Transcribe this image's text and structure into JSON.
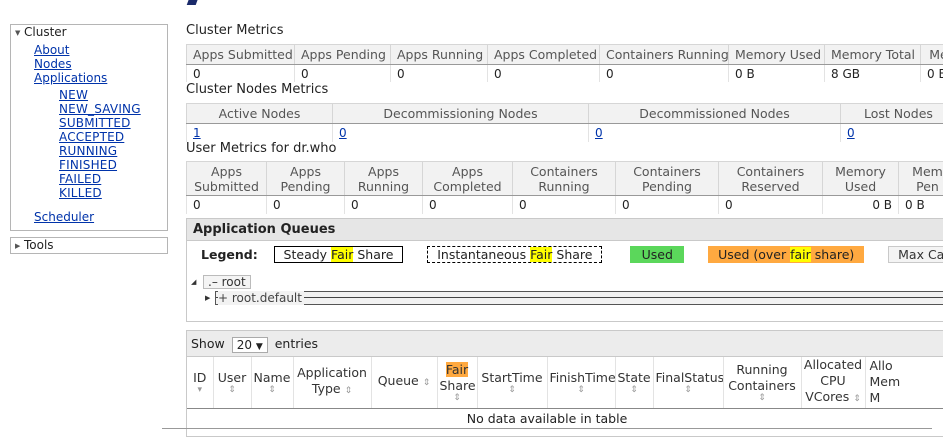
{
  "sidebar": {
    "cluster": {
      "title": "Cluster",
      "links": [
        "About",
        "Nodes",
        "Applications"
      ],
      "app_states": [
        "NEW",
        "NEW_SAVING",
        "SUBMITTED",
        "ACCEPTED",
        "RUNNING",
        "FINISHED",
        "FAILED",
        "KILLED"
      ],
      "scheduler": "Scheduler"
    },
    "tools": {
      "title": "Tools"
    }
  },
  "cluster_metrics": {
    "title": "Cluster Metrics",
    "headers": [
      "Apps Submitted",
      "Apps Pending",
      "Apps Running",
      "Apps Completed",
      "Containers Running",
      "Memory Used",
      "Memory Total",
      "Me"
    ],
    "values": [
      "0",
      "0",
      "0",
      "0",
      "0",
      "0 B",
      "8 GB",
      "0 B"
    ]
  },
  "cluster_nodes_metrics": {
    "title": "Cluster Nodes Metrics",
    "headers": [
      "Active Nodes",
      "Decommissioning Nodes",
      "Decommissioned Nodes",
      "Lost Nodes"
    ],
    "values": [
      "1",
      "0",
      "0",
      "0"
    ]
  },
  "user_metrics": {
    "title": "User Metrics for dr.who",
    "headers": [
      [
        "Apps",
        "Submitted"
      ],
      [
        "Apps",
        "Pending"
      ],
      [
        "Apps",
        "Running"
      ],
      [
        "Apps",
        "Completed"
      ],
      [
        "Containers",
        "Running"
      ],
      [
        "Containers",
        "Pending"
      ],
      [
        "Containers",
        "Reserved"
      ],
      [
        "Memory",
        "Used"
      ],
      [
        "Mem",
        "Pen"
      ]
    ],
    "values": [
      "0",
      "0",
      "0",
      "0",
      "0",
      "0",
      "0",
      "0 B",
      "0 B"
    ]
  },
  "app_queues": {
    "title": "Application Queues",
    "legend_label": "Legend:",
    "legend": {
      "steady_pre": "Steady ",
      "steady_hl": "Fair",
      "steady_post": " Share",
      "inst_pre": "Instantaneous ",
      "inst_hl": "Fair",
      "inst_post": " Share",
      "used": "Used",
      "over_pre": "Used (over ",
      "over_hl": "fair",
      "over_post": " share)",
      "max": "Max Cap"
    },
    "colors": {
      "used": "#5bd75b",
      "over": "#ffa940",
      "highlight": "#ffff00"
    },
    "root": ".– root",
    "default": "+ root.default"
  },
  "applications": {
    "show_label": "Show",
    "entries_value": "20",
    "entries_label": "entries",
    "columns": [
      [
        "ID"
      ],
      [
        "User"
      ],
      [
        "Name"
      ],
      [
        "Application",
        "Type"
      ],
      [
        "Queue"
      ],
      [
        "Fair",
        "Share"
      ],
      [
        "StartTime"
      ],
      [
        "FinishTime"
      ],
      [
        "State"
      ],
      [
        "FinalStatus"
      ],
      [
        "Running",
        "Containers"
      ],
      [
        "Allocated",
        "CPU",
        "VCores"
      ],
      [
        "Allo",
        "Mem",
        "M"
      ]
    ],
    "empty_message": "No data available in table"
  }
}
